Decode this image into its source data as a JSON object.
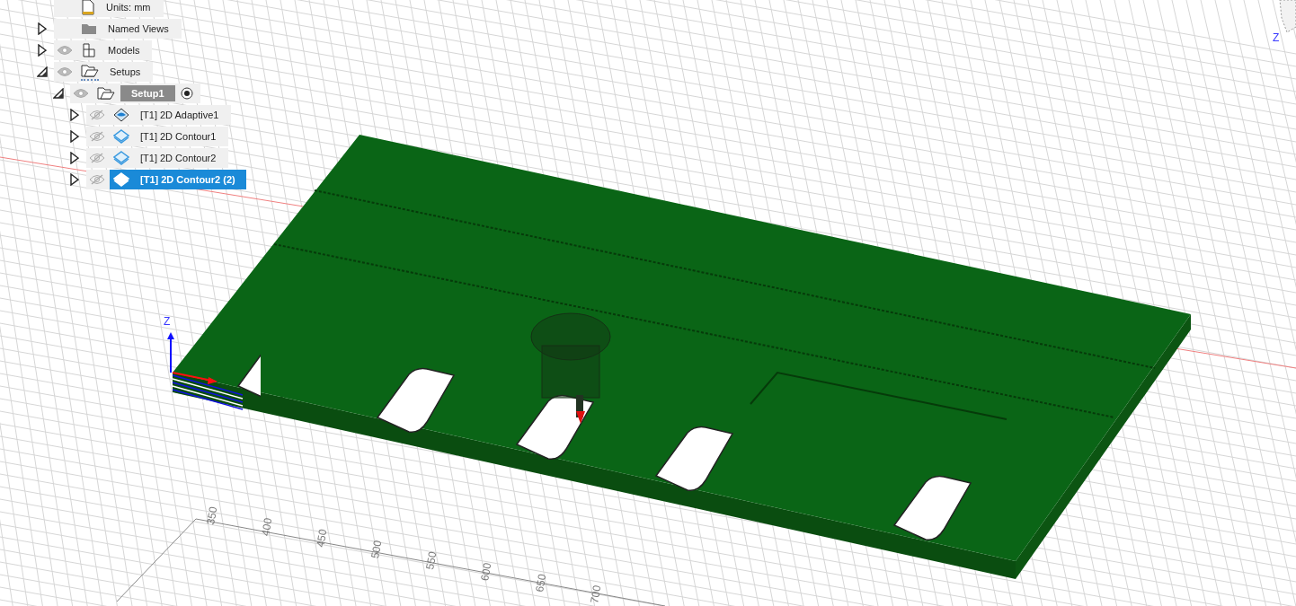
{
  "browser": {
    "items": [
      {
        "kind": "units",
        "label": "Units: mm",
        "selected": false
      },
      {
        "kind": "named_views",
        "label": "Named Views",
        "expanded": false,
        "selected": false
      },
      {
        "kind": "models",
        "label": "Models",
        "expanded": false,
        "visible": true,
        "selected": false
      },
      {
        "kind": "setups",
        "label": "Setups",
        "expanded": true,
        "visible": true,
        "selected": false,
        "children": [
          {
            "kind": "setup",
            "label": "Setup1",
            "expanded": true,
            "visible": true,
            "active": true,
            "selected": false,
            "children": [
              {
                "kind": "adaptive",
                "label": "[T1] 2D Adaptive1",
                "expanded": false,
                "visible": false,
                "selected": false
              },
              {
                "kind": "contour",
                "label": "[T1] 2D Contour1",
                "expanded": false,
                "visible": false,
                "selected": false
              },
              {
                "kind": "contour",
                "label": "[T1] 2D Contour2",
                "expanded": false,
                "visible": false,
                "selected": false
              },
              {
                "kind": "contour",
                "label": "[T1] 2D Contour2 (2)",
                "expanded": false,
                "visible": false,
                "selected": true
              }
            ]
          }
        ]
      }
    ]
  },
  "viewport": {
    "axis_label": "Z",
    "viewcube_label": "Z",
    "ruler_labels": [
      "350",
      "400",
      "450",
      "500",
      "550",
      "600",
      "650",
      "700"
    ]
  }
}
